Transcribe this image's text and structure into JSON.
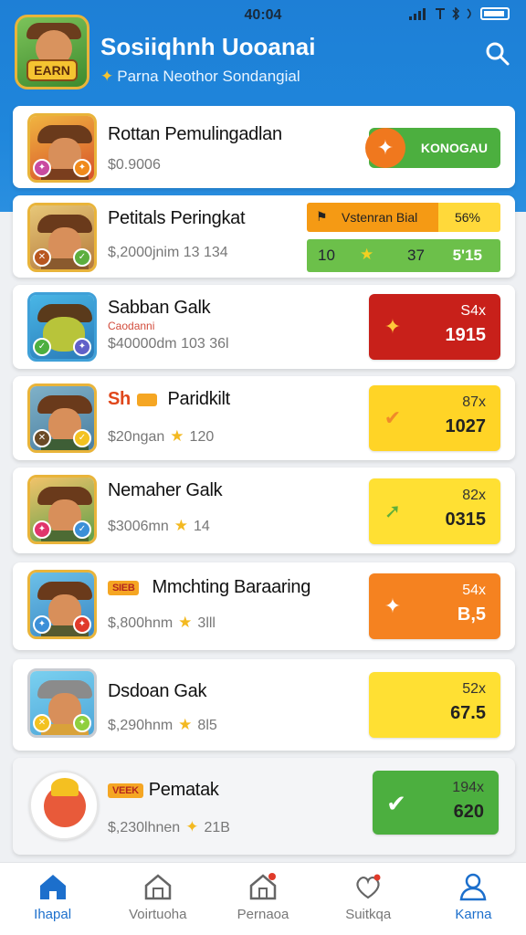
{
  "status_bar": {
    "time": "40:04"
  },
  "header": {
    "logo_text": "EARN",
    "title": "Sosiiqhnh Uooanai",
    "subtitle": "Parna Neothor Sondangial"
  },
  "items": [
    {
      "title": "Rottan Pemulingadlan",
      "subtitle": "$0.9006",
      "button": "KONOGAU"
    },
    {
      "title": "Petitals Peringkat",
      "subtitle": "$,2000jnim 13 134",
      "bar1_label": "Vstenran Bial",
      "bar1_value": "56%",
      "bar2_left": "10",
      "bar2_mid": "37",
      "bar2_right": "5'15"
    },
    {
      "title": "Sabban Galk",
      "tag": "Caodanni",
      "subtitle": "$40000dm 103 36l",
      "pct": "S4x",
      "value": "1915"
    },
    {
      "tag": "Sh",
      "title": "Paridkilt",
      "subtitle": "$20ngan",
      "coin_value": "120",
      "pct": "87x",
      "value": "1027"
    },
    {
      "title": "Nemaher Galk",
      "subtitle": "$3006mn",
      "coin_value": "14",
      "pct": "82x",
      "value": "0315"
    },
    {
      "tag": "SIEB",
      "title": "Mmchting Baraaring",
      "subtitle": "$,800hnm",
      "coin_value": "3lll",
      "pct": "54x",
      "value": "B,5"
    },
    {
      "title": "Dsdoan Gak",
      "subtitle": "$,290hnm",
      "coin_value": "8l5",
      "pct": "52x",
      "value": "67.5"
    },
    {
      "tag": "VEEK",
      "title": "Pematak",
      "subtitle": "$,230lhnen",
      "coin_value": "21B",
      "pct": "194x",
      "value": "620"
    }
  ],
  "nav": [
    {
      "label": "Ihapal",
      "icon": "home-icon"
    },
    {
      "label": "Voirtuoha",
      "icon": "house-outline-icon"
    },
    {
      "label": "Pernaoa",
      "icon": "house-notification-icon"
    },
    {
      "label": "Suitkqa",
      "icon": "heart-chat-icon"
    },
    {
      "label": "Karna",
      "icon": "profile-icon"
    }
  ],
  "colors": {
    "header_blue": "#1e7fd6",
    "green": "#4caf3f",
    "orange": "#f58220",
    "red": "#c8201a",
    "yellow": "#ffe033",
    "nav_active": "#1c6fcc"
  }
}
